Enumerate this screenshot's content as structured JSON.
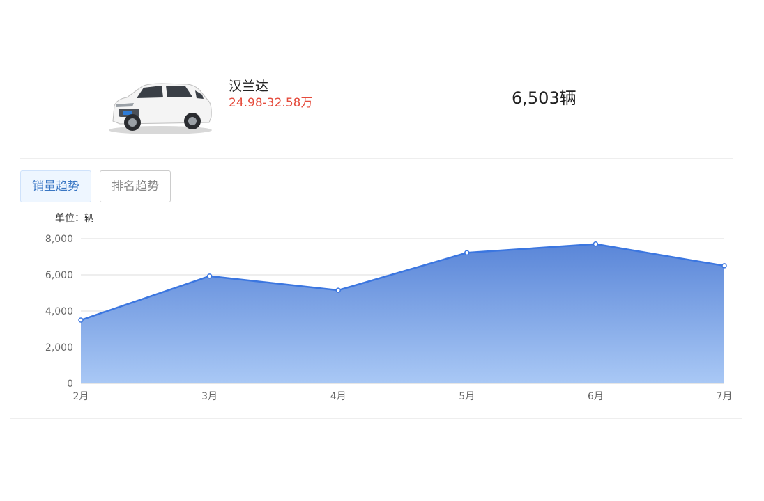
{
  "car": {
    "name": "汉兰达",
    "price": "24.98-32.58万",
    "sales_total": "6,503辆",
    "image_icon": "white-suv-photo"
  },
  "tabs": [
    {
      "label": "销量趋势",
      "active": true
    },
    {
      "label": "排名趋势",
      "active": false
    }
  ],
  "chart_data": {
    "type": "area",
    "unit_label": "单位：辆",
    "x": [
      "2月",
      "3月",
      "4月",
      "5月",
      "6月",
      "7月"
    ],
    "series": [
      {
        "values": [
          3500,
          5930,
          5150,
          7220,
          7700,
          6503
        ]
      }
    ],
    "ylim": [
      0,
      8000
    ],
    "yticks": [
      0,
      2000,
      4000,
      6000,
      8000
    ],
    "ytick_labels": [
      "0",
      "2,000",
      "4,000",
      "6,000",
      "8,000"
    ],
    "grid": true,
    "colors": {
      "line": "#3b76e0",
      "fill_top": "#5a86d8",
      "fill_bottom": "#a9c8f5",
      "grid": "#dddddd"
    }
  }
}
